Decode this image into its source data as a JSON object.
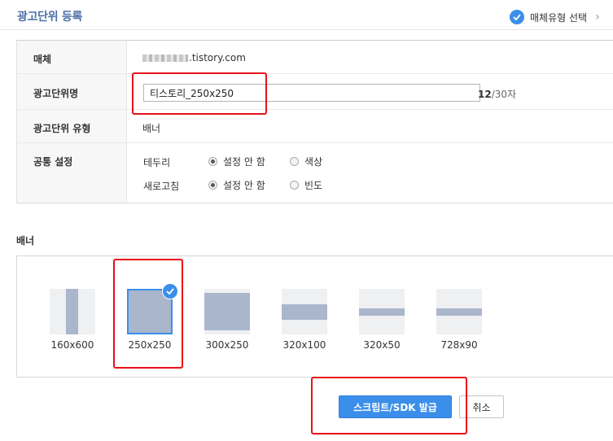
{
  "header": {
    "title": "광고단위 등록",
    "step_label": "매체유형 선택",
    "step_icon": "check-circle-icon",
    "arrow_icon": "chevron-right-icon"
  },
  "form": {
    "media": {
      "label": "매체",
      "value_suffix": ".tistory.com"
    },
    "ad_unit_name": {
      "label": "광고단위명",
      "value": "티스토리_250x250",
      "count": "12",
      "limit": "/30자"
    },
    "ad_unit_type": {
      "label": "광고단위 유형",
      "value": "배너"
    },
    "common_settings": {
      "label": "공통 설정",
      "border": {
        "label": "테두리",
        "option_off": "설정 안 함",
        "option_on": "색상",
        "selected": "설정 안 함"
      },
      "refresh": {
        "label": "새로고침",
        "option_off": "설정 안 함",
        "option_on": "빈도",
        "selected": "설정 안 함"
      }
    }
  },
  "banner": {
    "title": "배너",
    "selected": "250x250",
    "sizes": [
      {
        "label": "160x600"
      },
      {
        "label": "250x250"
      },
      {
        "label": "300x250"
      },
      {
        "label": "320x100"
      },
      {
        "label": "320x50"
      },
      {
        "label": "728x90"
      }
    ]
  },
  "actions": {
    "issue_label": "스크립트/SDK 발급",
    "cancel_label": "취소"
  },
  "colors": {
    "accent": "#3b8fea",
    "title": "#4a6fa5",
    "thumb_fill": "#aab6cc",
    "annotation": "#e8101a"
  }
}
